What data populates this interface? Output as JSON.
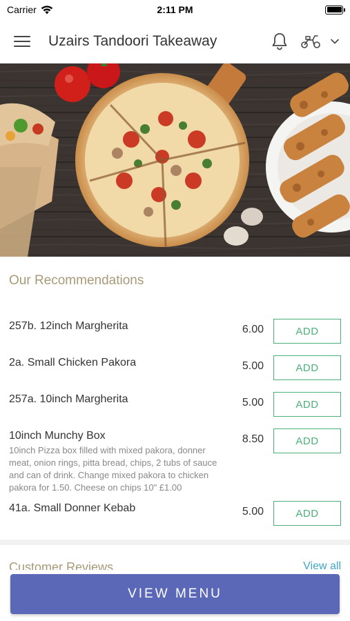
{
  "status_bar": {
    "carrier": "Carrier",
    "time": "2:11 PM"
  },
  "header": {
    "title": "Uzairs Tandoori Takeaway",
    "icons": [
      "menu-icon",
      "bell-icon",
      "delivery-scooter-icon",
      "chevron-down-icon"
    ]
  },
  "recommendations": {
    "title": "Our Recommendations",
    "add_label": "ADD",
    "items": [
      {
        "name": "257b. 12inch Margherita",
        "description": "",
        "price": "6.00"
      },
      {
        "name": "2a. Small Chicken Pakora",
        "description": "",
        "price": "5.00"
      },
      {
        "name": "257a. 10inch Margherita",
        "description": "",
        "price": "5.00"
      },
      {
        "name": "10inch Munchy Box",
        "description": "10inch Pizza box filled with mixed pakora, donner meat, onion rings, pitta bread, chips, 2 tubs of sauce and can of drink. Change mixed pakora to chicken pakora for 1.50. Cheese on chips 10\" £1.00",
        "price": "8.50"
      },
      {
        "name": "41a. Small Donner Kebab",
        "description": "",
        "price": "5.00"
      }
    ]
  },
  "reviews": {
    "title": "Customer Reviews",
    "view_all": "View all"
  },
  "view_menu_label": "VIEW MENU",
  "colors": {
    "accent_button": "#5b68b8",
    "add_green": "#4caf7a",
    "section_title": "#a89a78",
    "link": "#3fa6c4"
  }
}
